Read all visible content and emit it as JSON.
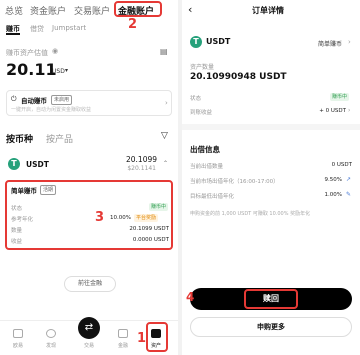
{
  "left": {
    "top_tabs": [
      "总览",
      "资金账户",
      "交易账户",
      "金融账户"
    ],
    "sub_tabs": [
      "赚币",
      "借贷",
      "Jumpstart"
    ],
    "asset_label": "赚币资产估值",
    "asset_value": "20.11",
    "asset_unit": "USD",
    "auto_earn_label": "自动赚币",
    "auto_earn_badge": "未启用",
    "auto_earn_desc": "一键开启，自动为闲置资金赚取收益",
    "group_tabs": [
      "按币种",
      "按产品"
    ],
    "coin": {
      "symbol": "USDT",
      "amount": "20.1099",
      "amount_usd": "$20.1141"
    },
    "product": {
      "name": "简单赚币",
      "tag": "活期",
      "rows": [
        {
          "label": "状态",
          "value": "赚币中"
        },
        {
          "label": "参考年化",
          "value": "10.00%",
          "badge": "平台奖励"
        },
        {
          "label": "数量",
          "value": "20.1099 USDT"
        },
        {
          "label": "收益",
          "value": "0.0000 USDT"
        }
      ]
    },
    "more_button": "前往金融",
    "nav": [
      "欧易",
      "发现",
      "交易",
      "金融",
      "资产"
    ],
    "annotations": [
      "1",
      "2",
      "3"
    ]
  },
  "right": {
    "title": "订单详情",
    "coin_symbol": "USDT",
    "product_type": "简单赚币",
    "holding_label": "资产数量",
    "holding_value": "20.10990948 USDT",
    "rows1": [
      {
        "label": "状态",
        "value": "赚币中"
      },
      {
        "label": "到账收益",
        "value": "+ 0 USDT"
      }
    ],
    "section2_title": "出借信息",
    "rows2": [
      {
        "label": "当前出借数量",
        "value": "0 USDT"
      },
      {
        "label": "当前市场出借年化（16:00-17:00）",
        "value": "9.50%"
      },
      {
        "label": "目标最低出借年化",
        "value": "1.00%"
      }
    ],
    "note": "申购资金的前 1,000 USDT 可赚取 10.00% 奖励年化",
    "redeem_button": "赎回",
    "subscribe_button": "申购更多",
    "annotation": "4"
  }
}
